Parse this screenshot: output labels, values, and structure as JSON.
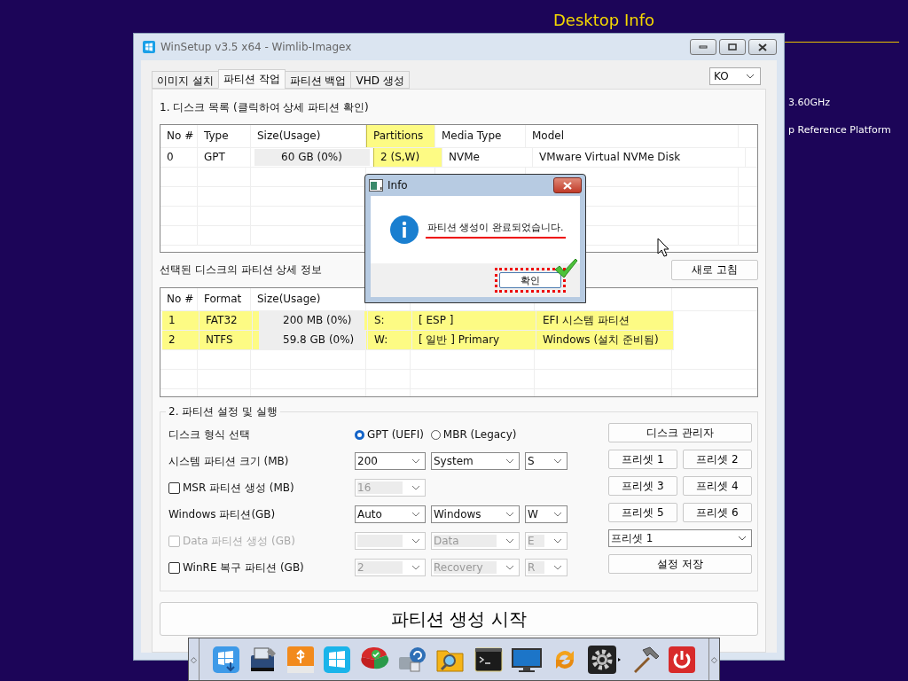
{
  "desktop_info": {
    "title": "Desktop Info",
    "lines": [
      "3.60GHz",
      "p Reference Platform"
    ]
  },
  "window": {
    "title": "WinSetup v3.5 x64 - Wimlib-Imagex"
  },
  "tabs": [
    {
      "label": "이미지 설치",
      "selected": false
    },
    {
      "label": "파티션 작업",
      "selected": true
    },
    {
      "label": "파티션 백업",
      "selected": false
    },
    {
      "label": "VHD 생성",
      "selected": false
    }
  ],
  "language_select": {
    "value": "KO"
  },
  "disk_list": {
    "title": "1. 디스크 목록 (클릭하여 상세 파티션 확인)",
    "columns": [
      {
        "label": "No #",
        "highlighted": false
      },
      {
        "label": "Type",
        "highlighted": false
      },
      {
        "label": "Size(Usage)",
        "highlighted": false
      },
      {
        "label": "Partitions",
        "highlighted": true
      },
      {
        "label": "Media Type",
        "highlighted": false
      },
      {
        "label": "Model",
        "highlighted": false
      }
    ],
    "rows": [
      [
        "0",
        "GPT",
        "60 GB (0%)",
        "2 (S,W)",
        "NVMe",
        "VMware Virtual NVMe Disk"
      ]
    ]
  },
  "partition_details": {
    "title": "선택된 디스크의 파티션 상세 정보",
    "refresh_button": "새로 고침",
    "columns": [
      "No #",
      "Format",
      "Size(Usage)"
    ],
    "rows": [
      {
        "highlighted": true,
        "cells": [
          "1",
          "FAT32",
          "200 MB (0%)",
          "S:",
          "[ ESP ]",
          "EFI 시스템 파티션"
        ]
      },
      {
        "highlighted": true,
        "cells": [
          "2",
          "NTFS",
          "59.8 GB (0%)",
          "W:",
          "[ 일반 ] Primary",
          "Windows (설치 준비됨)"
        ]
      }
    ]
  },
  "settings": {
    "title": "2. 파티션 설정 및 실행",
    "disk_format": {
      "label": "디스크 형식 선택",
      "options": [
        {
          "label": "GPT (UEFI)",
          "selected": true
        },
        {
          "label": "MBR (Legacy)",
          "selected": false
        }
      ]
    },
    "rows": [
      {
        "kind": "plain",
        "label": "시스템 파티션 크기 (MB)",
        "combos": [
          {
            "value": "200",
            "disabled": false
          },
          {
            "value": "System",
            "disabled": false
          },
          {
            "value": "S",
            "disabled": false
          }
        ]
      },
      {
        "kind": "checkbox",
        "label": "MSR 파티션 생성 (MB)",
        "checked": false,
        "disabled": false,
        "combos": [
          {
            "value": "16",
            "disabled": true
          }
        ]
      },
      {
        "kind": "plain",
        "label": "Windows 파티션(GB)",
        "combos": [
          {
            "value": "Auto",
            "disabled": false
          },
          {
            "value": "Windows",
            "disabled": false
          },
          {
            "value": "W",
            "disabled": false
          }
        ]
      },
      {
        "kind": "checkbox",
        "label": "Data 파티션 생성 (GB)",
        "checked": false,
        "disabled": true,
        "combos": [
          {
            "disabled": true
          },
          {
            "value": "Data",
            "disabled": true
          },
          {
            "value": "E",
            "disabled": true
          }
        ]
      },
      {
        "kind": "checkbox",
        "label": "WinRE 복구 파티션 (GB)",
        "checked": false,
        "disabled": false,
        "combos": [
          {
            "value": "2",
            "disabled": true
          },
          {
            "value": "Recovery",
            "disabled": true
          },
          {
            "value": "R",
            "disabled": true
          }
        ]
      }
    ],
    "disk_manager_button": "디스크 관리자",
    "presets": [
      "프리셋 1",
      "프리셋 2",
      "프리셋 3",
      "프리셋 4",
      "프리셋 5",
      "프리셋 6"
    ],
    "preset_select": "프리셋 1",
    "save_button": "설정 저장"
  },
  "start_button": "파티션 생성 시작",
  "taskbar": {
    "grips": [
      "◇",
      "◇"
    ]
  },
  "dialog": {
    "title": "Info",
    "message": "파티션 생성이 완료되었습니다.",
    "ok_button": "확인"
  }
}
